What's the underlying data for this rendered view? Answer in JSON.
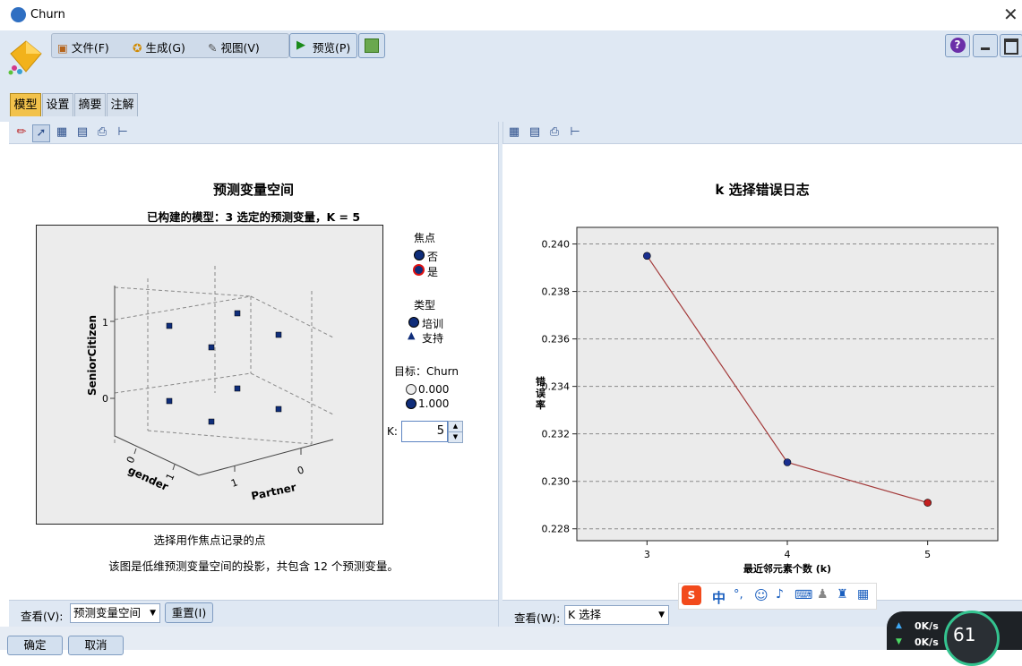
{
  "window": {
    "title": "Churn"
  },
  "menu": {
    "file": "文件(F)",
    "generate": "生成(G)",
    "view": "视图(V)",
    "preview": "预览(P)"
  },
  "tabs": [
    "模型",
    "设置",
    "摘要",
    "注解"
  ],
  "left_panel": {
    "title": "预测变量空间",
    "subtitle": "已构建的模型：3 选定的预测变量，K = 5",
    "axis_z_label": "SeniorCitizen",
    "axis_x_label": "gender",
    "axis_y_label": "Partner",
    "z_ticks": [
      "1",
      "0"
    ],
    "x_ticks": [
      "0",
      "1"
    ],
    "y_ticks": [
      "1",
      "0"
    ],
    "legend_focus_title": "焦点",
    "legend_focus_no": "否",
    "legend_focus_yes": "是",
    "legend_type_title": "类型",
    "legend_type_train": "培训",
    "legend_type_holdout": "支持",
    "legend_target_title": "目标：Churn",
    "legend_target_0": "0.000",
    "legend_target_1": "1.000",
    "k_label": "K:",
    "k_value": "5",
    "caption1": "选择用作焦点记录的点",
    "caption2": "该图是低维预测变量空间的投影，共包含 12 个预测变量。",
    "view_label": "查看(V):",
    "view_value": "预测变量空间",
    "reset_label": "重置(I)"
  },
  "right_panel": {
    "view_label": "查看(W):",
    "view_value": "K 选择"
  },
  "chart_data": {
    "type": "line",
    "title": "k 选择错误日志",
    "xlabel": "最近邻元素个数 (k)",
    "ylabel": "错误率",
    "x": [
      3,
      4,
      5
    ],
    "values": [
      0.2395,
      0.2308,
      0.2291
    ],
    "x_ticks": [
      "3",
      "4",
      "5"
    ],
    "y_ticks": [
      "0.240",
      "0.238",
      "0.236",
      "0.234",
      "0.232",
      "0.230",
      "0.228"
    ],
    "ylim": [
      0.2275,
      0.2407
    ],
    "grid": "horizontal-dashed",
    "line_color": "#a33a3a",
    "point_colors": [
      "#1a2f8f",
      "#1a2f8f",
      "#c41f1f"
    ]
  },
  "bottom_buttons": {
    "ok": "确定",
    "cancel": "取消"
  },
  "net_widget": {
    "up": "0K/s",
    "down": "0K/s",
    "percent": "61"
  },
  "ime": {
    "lang": "中"
  }
}
